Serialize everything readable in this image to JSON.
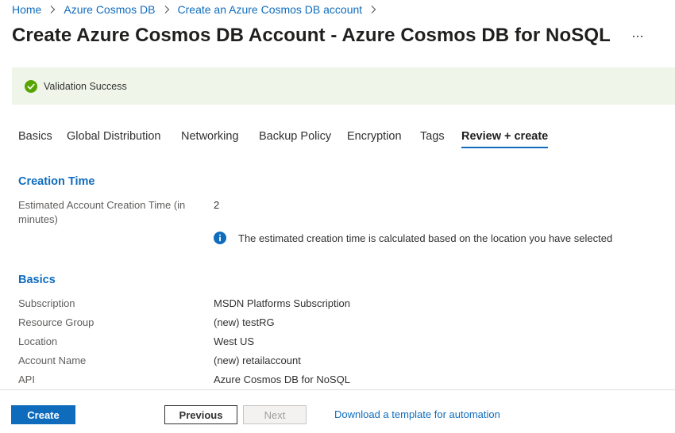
{
  "breadcrumb": {
    "items": [
      "Home",
      "Azure Cosmos DB",
      "Create an Azure Cosmos DB account"
    ]
  },
  "header": {
    "title": "Create Azure Cosmos DB Account - Azure Cosmos DB for NoSQL",
    "more_label": "···"
  },
  "banner": {
    "text": "Validation Success",
    "icon": "check-circle-icon",
    "color": "#57a300",
    "background": "#eff6e9"
  },
  "tabs": [
    {
      "label": "Basics"
    },
    {
      "label": "Global Distribution"
    },
    {
      "label": "Networking"
    },
    {
      "label": "Backup Policy"
    },
    {
      "label": "Encryption"
    },
    {
      "label": "Tags"
    },
    {
      "label": "Review + create",
      "active": true
    }
  ],
  "creation_time": {
    "title": "Creation Time",
    "label_line1": "Estimated Account Creation Time (in",
    "label_line2": "minutes)",
    "value": "2",
    "info_text": "The estimated creation time is calculated based on the location you have selected",
    "info_icon": "info-icon"
  },
  "basics": {
    "title": "Basics",
    "rows": [
      {
        "label": "Subscription",
        "value": "MSDN Platforms Subscription"
      },
      {
        "label": "Resource Group",
        "value": "(new) testRG"
      },
      {
        "label": "Location",
        "value": "West US"
      },
      {
        "label": "Account Name",
        "value": "(new) retailaccount"
      },
      {
        "label": "API",
        "value": "Azure Cosmos DB for NoSQL"
      }
    ]
  },
  "footer": {
    "create_label": "Create",
    "previous_label": "Previous",
    "next_label": "Next",
    "download_label": "Download a template for automation"
  },
  "colors": {
    "accent": "#0f6cbd",
    "success": "#57a300"
  }
}
